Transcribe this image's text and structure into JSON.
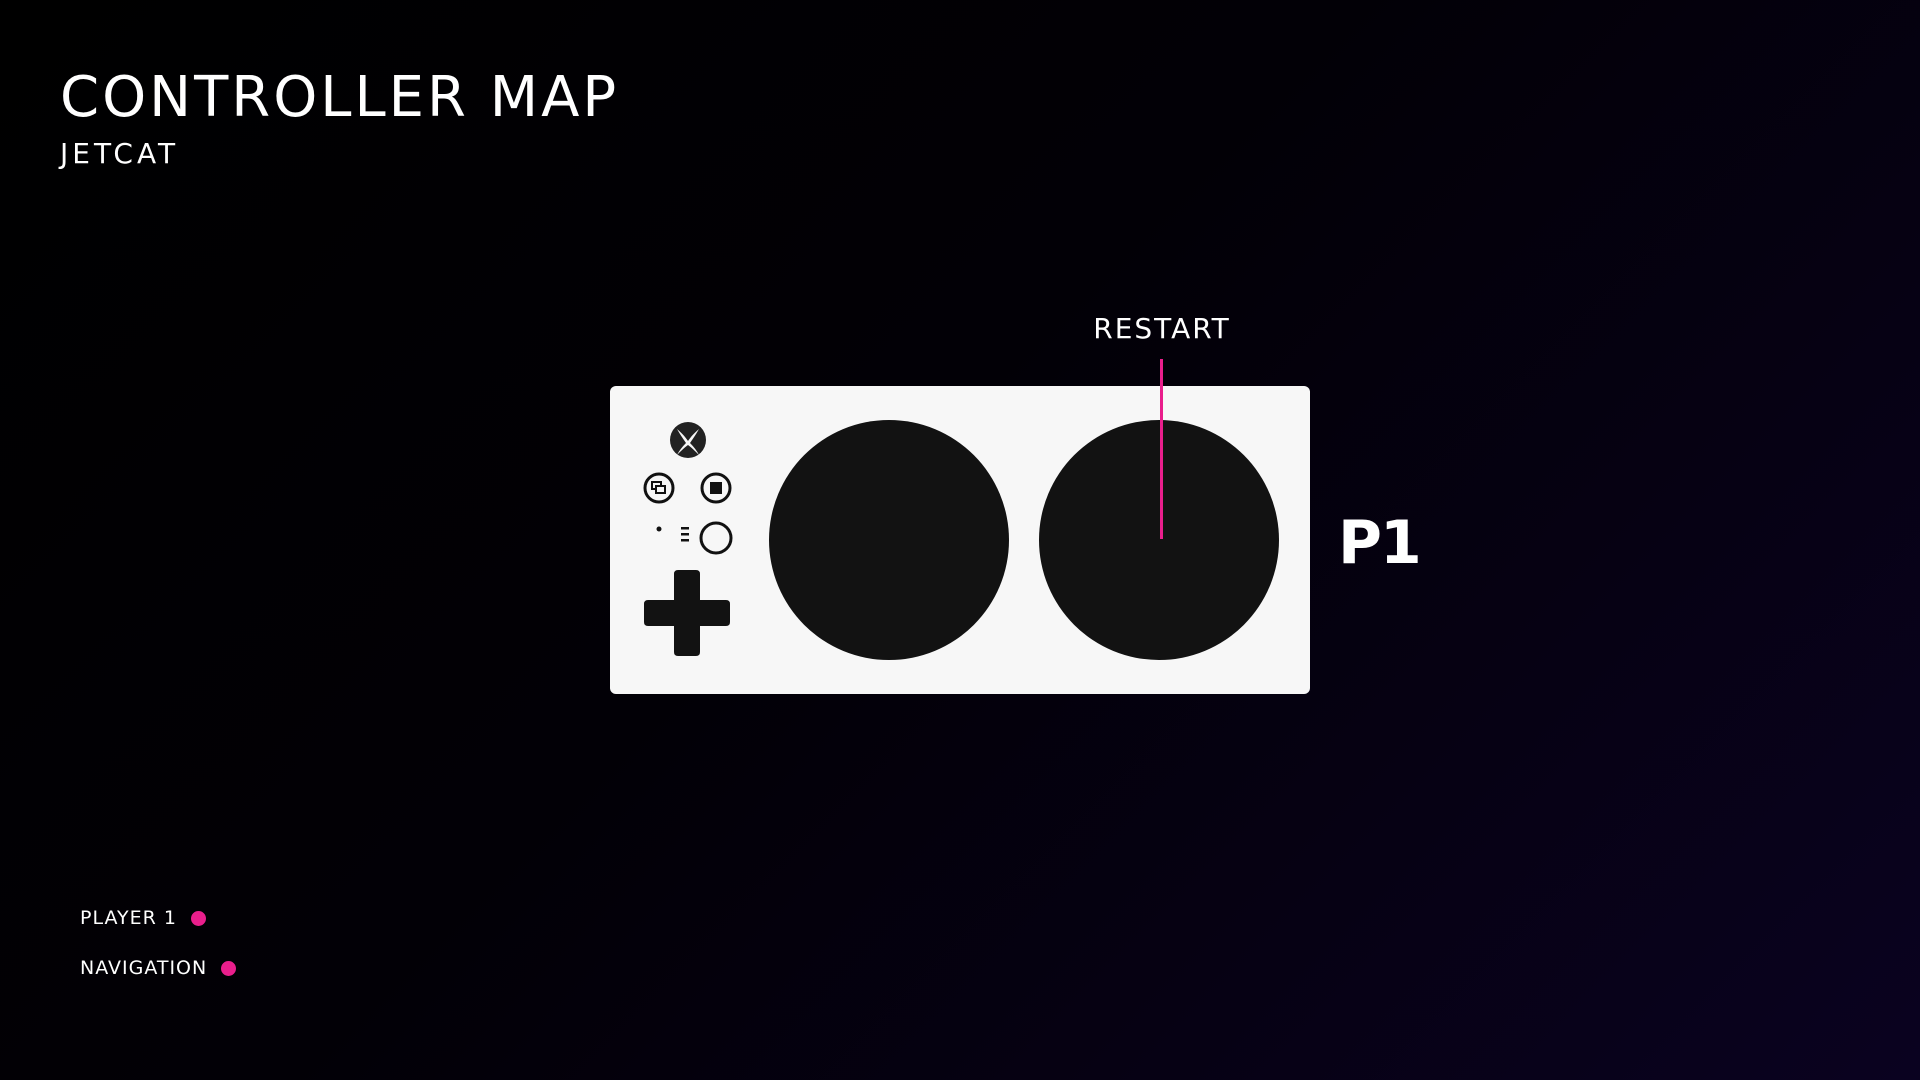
{
  "header": {
    "title": "CONTROLLER MAP",
    "subtitle": "JETCAT"
  },
  "mapping": {
    "label": "RESTART"
  },
  "controller": {
    "player_tag": "P1"
  },
  "legend": {
    "items": [
      {
        "label": "PLAYER 1",
        "color": "#e91e8c"
      },
      {
        "label": "NAVIGATION",
        "color": "#e91e8c"
      }
    ]
  },
  "colors": {
    "accent": "#e91e8c",
    "controller_body": "#f7f7f7",
    "controller_buttons": "#121212",
    "background": "#000000"
  },
  "icons": [
    "xbox-logo-icon",
    "view-button-icon",
    "menu-button-icon",
    "profile-button-icon",
    "dpad-icon"
  ]
}
